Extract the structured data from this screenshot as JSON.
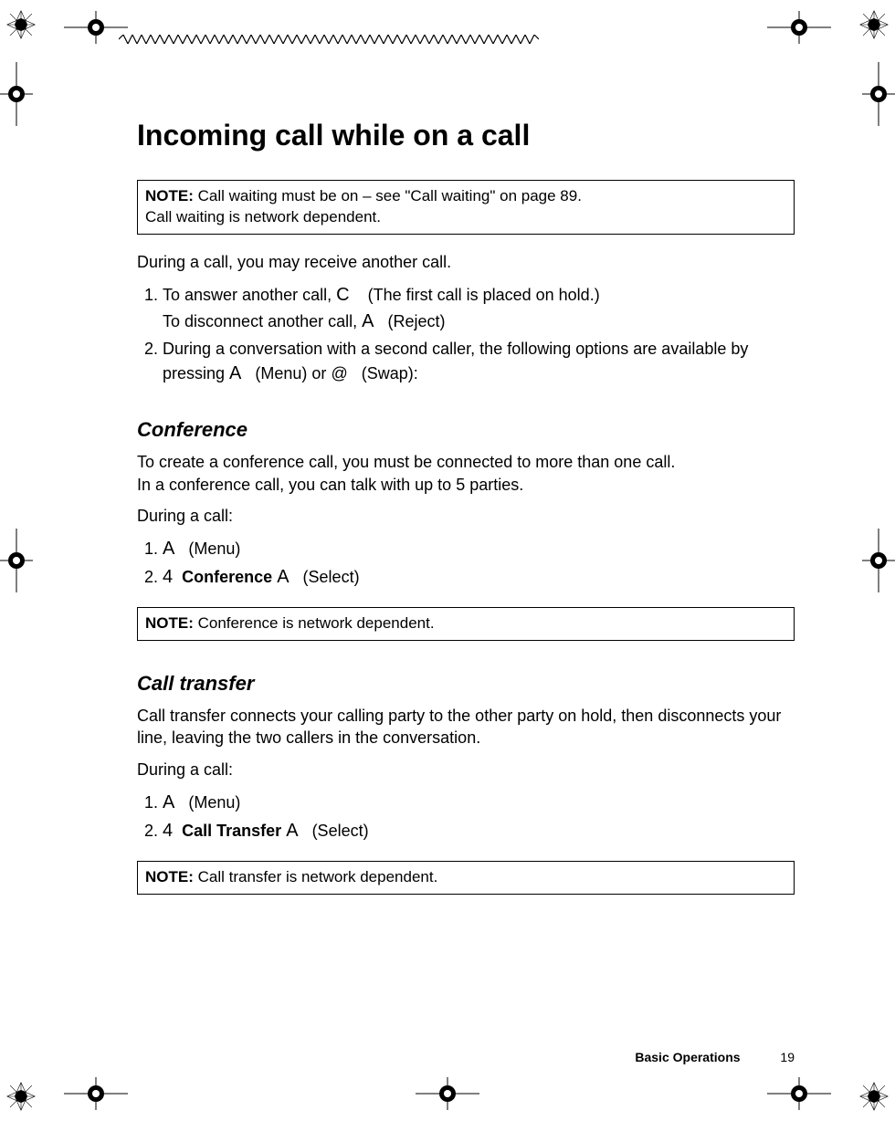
{
  "title": "Incoming call while on a call",
  "note1_label": "NOTE:",
  "note1_line1": " Call waiting must be on – see \"Call waiting\" on page 89.",
  "note1_line2": "Call waiting is network dependent.",
  "intro": "During a call, you may receive another call.",
  "step1a_pre": "To answer another call, ",
  "step1a_key": "C",
  "step1a_post": " (The first call is placed on hold.)",
  "step1b_pre": "To disconnect another call, ",
  "step1b_key": "A",
  "step1b_post": " (Reject)",
  "step2_pre": "During a conversation with a second caller, the following options are available by pressing ",
  "step2_key1": "A",
  "step2_mid1": " (Menu) or ",
  "step2_key2": "@",
  "step2_mid2": " (Swap):",
  "conf_head": "Conference",
  "conf_p1": "To create a conference call, you must be connected to more than one call.",
  "conf_p2": "In a conference call, you can talk with up to 5 parties.",
  "conf_during": "During a call:",
  "conf_s1_key": "A",
  "conf_s1_post": " (Menu)",
  "conf_s2_key1": "4",
  "conf_s2_bold": "Conference",
  "conf_s2_key2": "A",
  "conf_s2_post": " (Select)",
  "note2_label": "NOTE:",
  "note2_text": " Conference is network dependent.",
  "ct_head": "Call transfer",
  "ct_p": "Call transfer connects your calling party to the other party on hold, then disconnects your line, leaving the two callers in the conversation.",
  "ct_during": "During a call:",
  "ct_s1_key": "A",
  "ct_s1_post": " (Menu)",
  "ct_s2_key1": "4",
  "ct_s2_bold": "Call Transfer",
  "ct_s2_key2": "A",
  "ct_s2_post": " (Select)",
  "note3_label": "NOTE:",
  "note3_text": " Call transfer is network dependent.",
  "footer_chapter": "Basic Operations",
  "footer_page": "19"
}
